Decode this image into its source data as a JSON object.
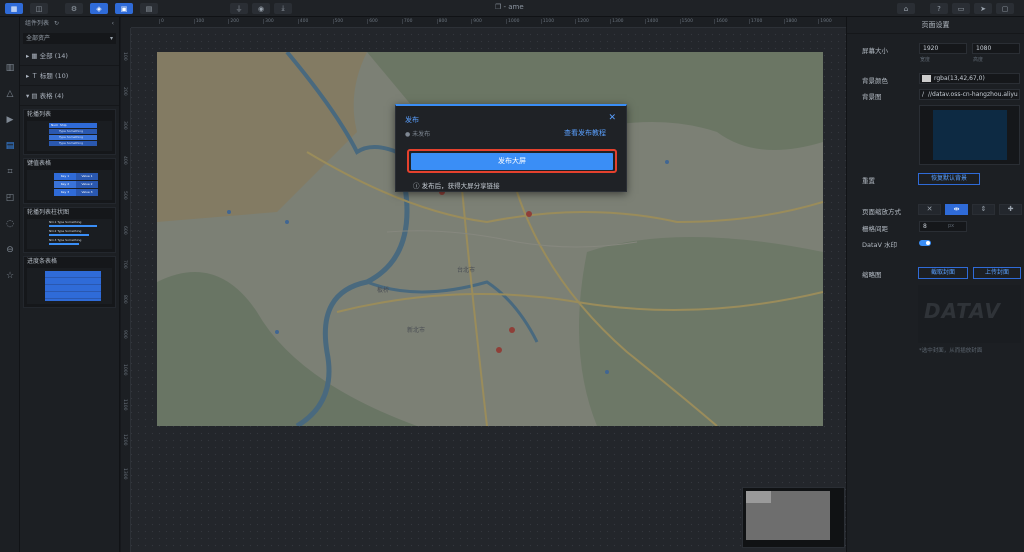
{
  "app": {
    "doc_title": "- ame"
  },
  "left_panel": {
    "title": "组件列表",
    "asset_select": "全部资产",
    "categories": [
      {
        "label": "全部 (14)"
      },
      {
        "label": "标题 (10)"
      },
      {
        "label": "表格 (4)"
      }
    ],
    "cards": [
      {
        "title": "轮播列表",
        "rows": [
          "Type Something",
          "Type Something",
          "Type Something"
        ],
        "header": [
          "Num",
          "Ship"
        ]
      },
      {
        "title": "键值表格",
        "rows": [
          "Key 1",
          "Key 2",
          "Key 3"
        ],
        "values": [
          "Value 1",
          "Value 2",
          "Value 3"
        ]
      },
      {
        "title": "轮播列表柱状图",
        "rows": [
          "NO.1",
          "NO.2",
          "NO.3"
        ],
        "values": [
          "Type Something",
          "Type Something",
          "Type Something"
        ]
      },
      {
        "title": "进度条表格"
      }
    ]
  },
  "ruler": {
    "marks": [
      "0",
      "100",
      "200",
      "300",
      "400",
      "500",
      "600",
      "700",
      "800",
      "900",
      "1000",
      "1100",
      "1200",
      "1300",
      "1400",
      "1500",
      "1600",
      "1700",
      "1800",
      "1900"
    ]
  },
  "vruler": {
    "marks": [
      "100",
      "200",
      "300",
      "400",
      "500",
      "600",
      "700",
      "800",
      "900",
      "1000",
      "1100",
      "1200",
      "1300"
    ]
  },
  "publish_modal": {
    "title": "发布",
    "status": "未发布",
    "tutorial_link": "查看发布教程",
    "publish_button": "发布大屏",
    "hint": "发布后，获得大屏分享链接"
  },
  "right_panel": {
    "title": "页面设置",
    "screen_size_label": "屏幕大小",
    "width": "1920",
    "height": "1080",
    "width_sub": "宽度",
    "height_sub": "高度",
    "bg_color_label": "背景颜色",
    "bg_color_value": "rgba(13,42,67,0)",
    "bg_image_label": "背景图",
    "bg_image_url": "//datav.oss-cn-hangzhou.aliyu",
    "reset_label": "重置",
    "reset_button": "恢复默认背景",
    "scale_label": "页面缩放方式",
    "grid_label": "栅格间距",
    "grid_value": "8",
    "grid_unit": "px",
    "watermark_label": "DataV 水印",
    "thumb_label": "缩略图",
    "capture_button": "截取封面",
    "upload_button": "上传封面",
    "thumb_caption": "DATAV",
    "thumb_hint": "*选中封面，从而插放封面"
  },
  "map_labels": [
    "台北市",
    "新北市",
    "士林",
    "板桥"
  ],
  "colors": {
    "accent": "#2f6bd8",
    "highlight": "#e5412d",
    "primary_btn": "#3a8ef6"
  }
}
